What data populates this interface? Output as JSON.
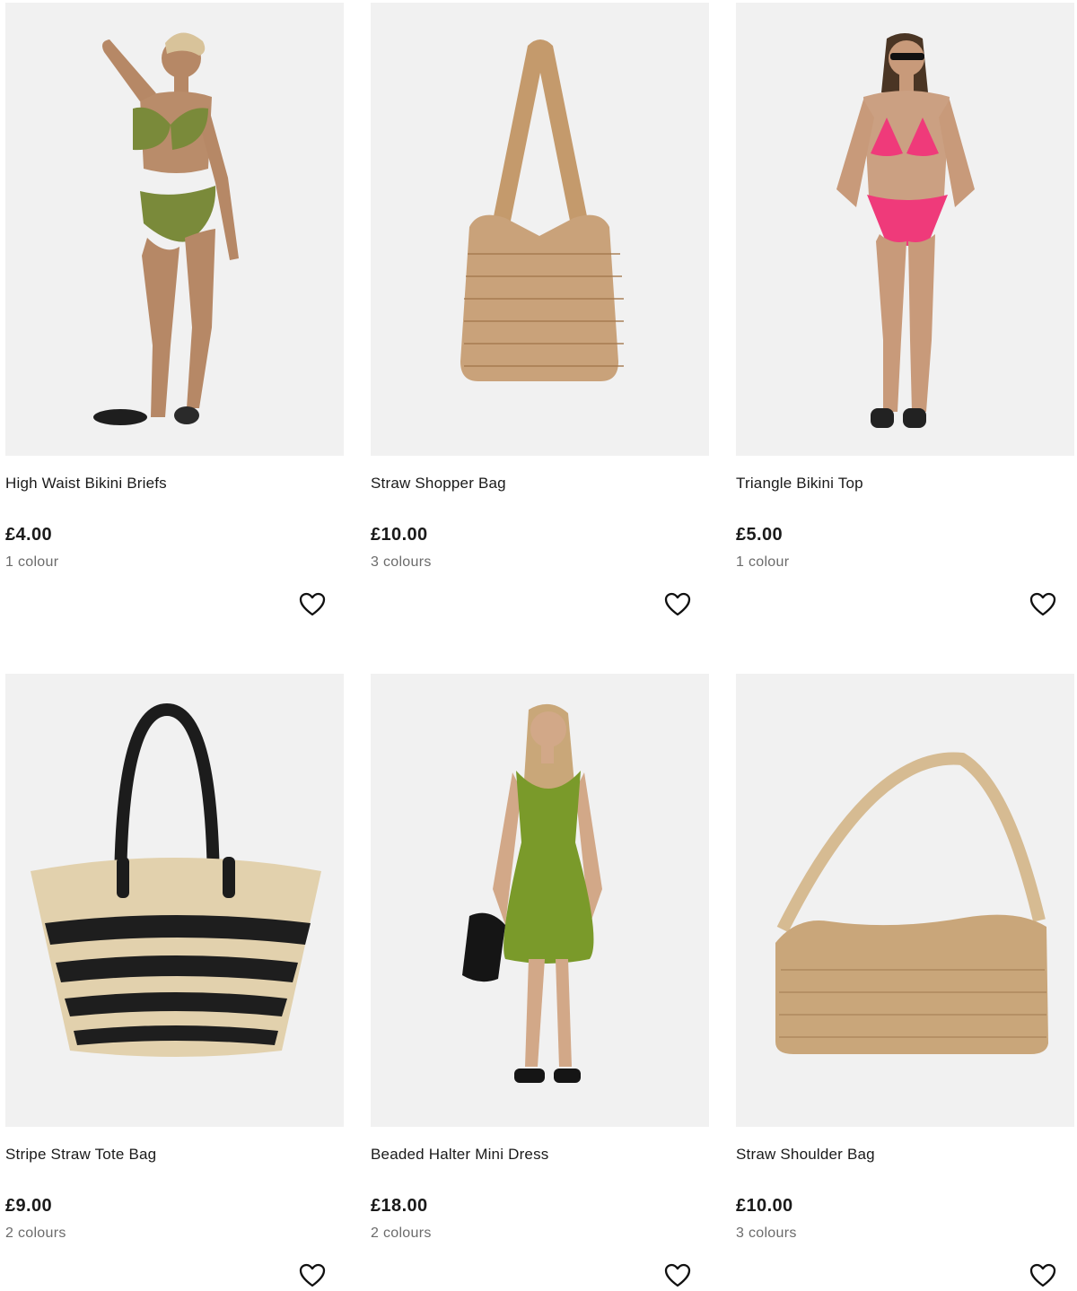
{
  "products": [
    {
      "name": "High Waist Bikini Briefs",
      "price": "£4.00",
      "colours": "1 colour",
      "image": "green-bikini-model",
      "favourite_icon": "heart-outline-icon"
    },
    {
      "name": "Straw Shopper Bag",
      "price": "£10.00",
      "colours": "3 colours",
      "image": "straw-shopper-bag",
      "favourite_icon": "heart-outline-icon"
    },
    {
      "name": "Triangle Bikini Top",
      "price": "£5.00",
      "colours": "1 colour",
      "image": "pink-bikini-model",
      "favourite_icon": "heart-outline-icon"
    },
    {
      "name": "Stripe Straw Tote Bag",
      "price": "£9.00",
      "colours": "2 colours",
      "image": "striped-straw-tote",
      "favourite_icon": "heart-outline-icon"
    },
    {
      "name": "Beaded Halter Mini Dress",
      "price": "£18.00",
      "colours": "2 colours",
      "image": "green-dress-model",
      "favourite_icon": "heart-outline-icon"
    },
    {
      "name": "Straw Shoulder Bag",
      "price": "£10.00",
      "colours": "3 colours",
      "image": "straw-shoulder-bag",
      "favourite_icon": "heart-outline-icon"
    }
  ],
  "colors": {
    "image_bg": "#f0f0f0",
    "price_text": "#1a1a1a",
    "secondary_text": "#6b6b6b"
  }
}
